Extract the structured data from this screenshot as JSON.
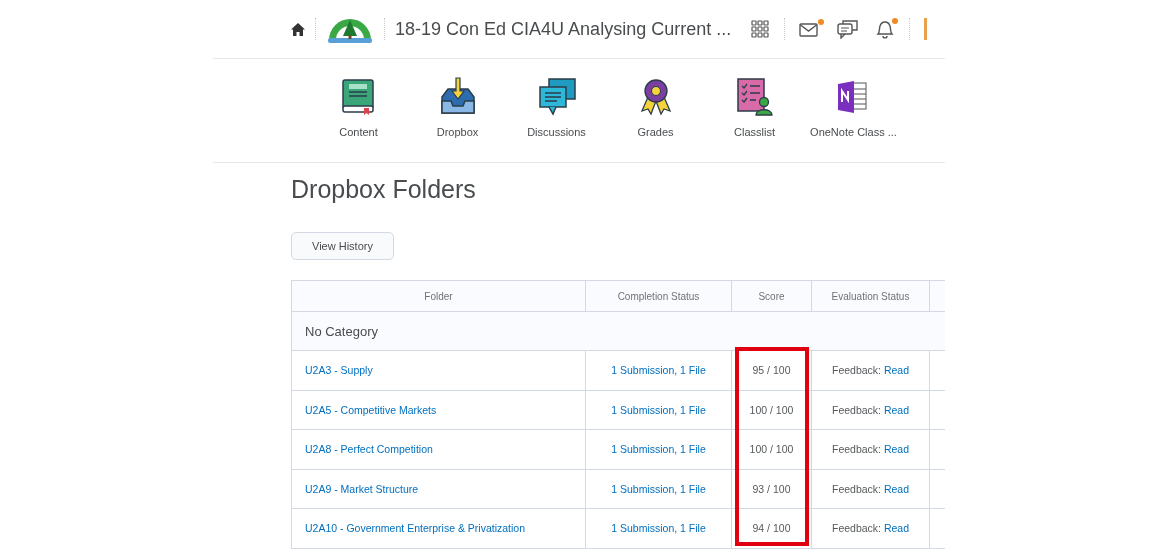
{
  "topbar": {
    "title": "18-19 Con Ed CIA4U Analysing Current ...",
    "alerts": [
      {
        "kind": "grid",
        "badge": false
      },
      {
        "kind": "mail",
        "badge": true
      },
      {
        "kind": "chat",
        "badge": false
      },
      {
        "kind": "bell",
        "badge": true
      }
    ]
  },
  "nav": [
    {
      "kind": "content",
      "label": "Content"
    },
    {
      "kind": "dropbox",
      "label": "Dropbox"
    },
    {
      "kind": "discussions",
      "label": "Discussions"
    },
    {
      "kind": "grades",
      "label": "Grades"
    },
    {
      "kind": "classlist",
      "label": "Classlist"
    },
    {
      "kind": "onenote",
      "label": "OneNote Class ..."
    }
  ],
  "heading": "Dropbox Folders",
  "buttons": [
    "View History"
  ],
  "table": {
    "columns": [
      {
        "label": "Folder",
        "highlighted": false
      },
      {
        "label": "Completion Status",
        "highlighted": false
      },
      {
        "label": "Score",
        "highlighted": true
      },
      {
        "label": "Evaluation Status",
        "highlighted": false
      }
    ],
    "category": "No Category",
    "rows": [
      {
        "folder": "U2A3 - Supply",
        "completion": "1 Submission, 1 File",
        "score": "95 / 100",
        "evaluation": "Feedback:",
        "link": "Read"
      },
      {
        "folder": "U2A5 - Competitive Markets",
        "completion": "1 Submission, 1 File",
        "score": "100 / 100",
        "evaluation": "Feedback:",
        "link": "Read"
      },
      {
        "folder": "U2A8 - Perfect Competition",
        "completion": "1 Submission, 1 File",
        "score": "100 / 100",
        "evaluation": "Feedback:",
        "link": "Read"
      },
      {
        "folder": "U2A9 - Market Structure",
        "completion": "1 Submission, 1 File",
        "score": "93 / 100",
        "evaluation": "Feedback:",
        "link": "Read"
      },
      {
        "folder": "U2A10 - Government Enterprise & Privatization",
        "completion": "1 Submission, 1 File",
        "score": "94 / 100",
        "evaluation": "Feedback:",
        "link": "Read"
      }
    ]
  }
}
